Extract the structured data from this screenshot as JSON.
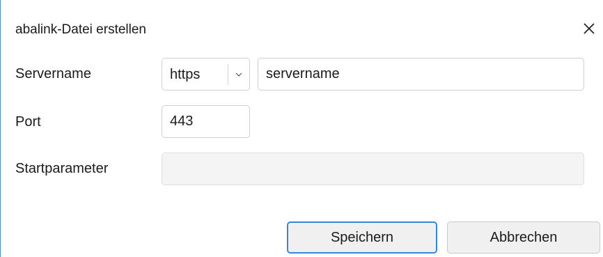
{
  "dialog": {
    "title": "abalink-Datei erstellen",
    "close_icon": "close-icon"
  },
  "form": {
    "server": {
      "label": "Servername",
      "protocol": "https",
      "value": "servername"
    },
    "port": {
      "label": "Port",
      "value": "443"
    },
    "startparameter": {
      "label": "Startparameter",
      "value": ""
    }
  },
  "buttons": {
    "save_label": "Speichern",
    "cancel_label": "Abbrechen"
  },
  "colors": {
    "accent": "#3a84d8",
    "field_border": "#cfcfcf",
    "disabled_field": "#f4f4f4"
  }
}
